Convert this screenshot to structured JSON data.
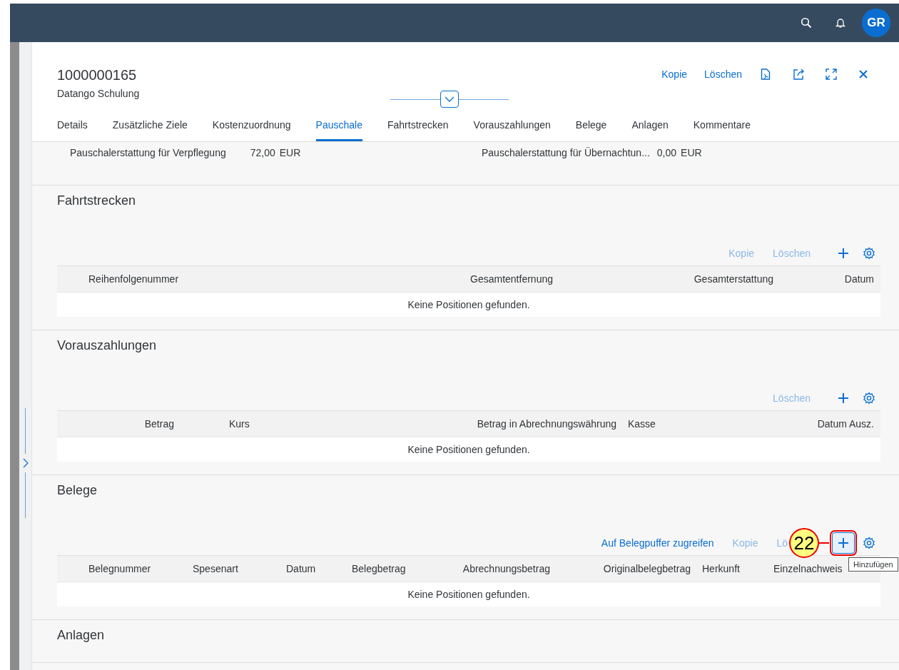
{
  "shell_bar": {
    "avatar": "GR"
  },
  "header": {
    "title": "1000000165",
    "subtitle": "Datango Schulung",
    "actions": [
      "Kopie",
      "Löschen"
    ]
  },
  "tabs": [
    {
      "label": "Details",
      "selected": false
    },
    {
      "label": "Zusätzliche Ziele",
      "selected": false
    },
    {
      "label": "Kostenzuordnung",
      "selected": false
    },
    {
      "label": "Pauschale",
      "selected": true
    },
    {
      "label": "Fahrtstrecken",
      "selected": false
    },
    {
      "label": "Vorauszahlungen",
      "selected": false
    },
    {
      "label": "Belege",
      "selected": false
    },
    {
      "label": "Anlagen",
      "selected": false
    },
    {
      "label": "Kommentare",
      "selected": false
    }
  ],
  "pauschale": [
    {
      "label": "Pauschalerstattung für Verpflegung",
      "value": "72,00",
      "currency": "EUR"
    },
    {
      "label": "Pauschalerstattung für Übernachtun...",
      "value": "0,00",
      "currency": "EUR"
    }
  ],
  "sections": [
    {
      "title": "Fahrtstrecken",
      "toolbar": [
        {
          "label": "Kopie",
          "kind": "text",
          "disabled": true
        },
        {
          "label": "Löschen",
          "kind": "text",
          "disabled": true
        },
        {
          "kind": "add"
        },
        {
          "kind": "settings"
        }
      ],
      "columns": [
        "Reihenfolgenummer",
        "Gesamtentfernung",
        "Gesamterstattung",
        "Datum"
      ],
      "empty_text": "Keine Positionen gefunden."
    },
    {
      "title": "Vorauszahlungen",
      "toolbar": [
        {
          "label": "Löschen",
          "kind": "text",
          "disabled": true
        },
        {
          "kind": "add"
        },
        {
          "kind": "settings"
        }
      ],
      "columns": [
        "Betrag",
        "Kurs",
        "Betrag in Abrechnungswährung",
        "Kasse",
        "Datum Ausz."
      ],
      "empty_text": "Keine Positionen gefunden."
    },
    {
      "title": "Belege",
      "toolbar": [
        {
          "label": "Auf Belegpuffer zugreifen",
          "kind": "text",
          "disabled": false
        },
        {
          "label": "Kopie",
          "kind": "text",
          "disabled": true
        },
        {
          "label": "Lö",
          "kind": "text",
          "disabled": true
        },
        {
          "kind": "callout",
          "label": "22"
        },
        {
          "kind": "add",
          "highlighted": true,
          "tooltip": "Hinzufügen"
        },
        {
          "kind": "settings"
        }
      ],
      "columns": [
        "Belegnummer",
        "Spesenart",
        "Datum",
        "Belegbetrag",
        "Abrechnungsbetrag",
        "Originalbelegbetrag",
        "Herkunft",
        "Einzelnachweis"
      ],
      "empty_text": "Keine Positionen gefunden."
    },
    {
      "title": "Anlagen"
    }
  ]
}
